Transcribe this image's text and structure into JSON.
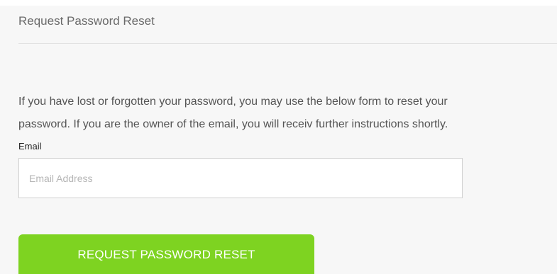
{
  "form": {
    "heading": "Request Password Reset",
    "description_line1": "If you have lost or forgotten your password, you may use the below form to reset your",
    "description_line2": "password. If you are the owner of the email, you will receiv further instructions shortly.",
    "email_label": "Email",
    "email_value": "",
    "email_placeholder": "Email Address",
    "submit_label": "REQUEST PASSWORD RESET"
  },
  "colors": {
    "panel_background": "#f7f7f7",
    "button_background": "#7ed321",
    "button_text": "#ffffff"
  }
}
